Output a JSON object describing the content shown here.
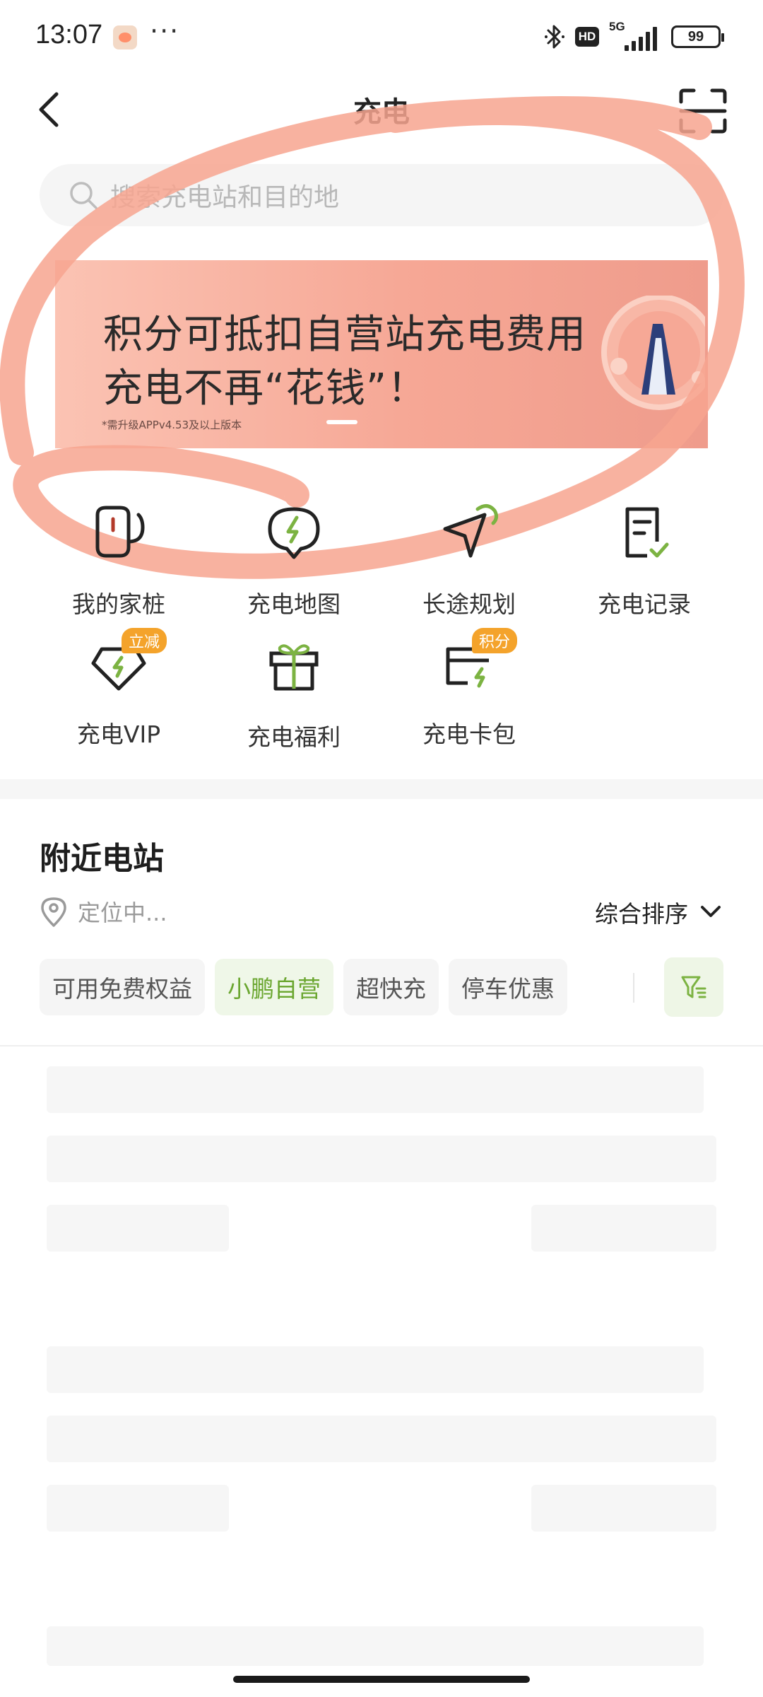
{
  "status_bar": {
    "time": "13:07",
    "dots": "···",
    "hd": "HD",
    "network": "5G",
    "battery": "99"
  },
  "header": {
    "title": "充电"
  },
  "search": {
    "placeholder": "搜索充电站和目的地"
  },
  "banner": {
    "line1": "积分可抵扣自营站充电费用",
    "line2": "充电不再“花钱”！",
    "note": "*需升级APPv4.53及以上版本"
  },
  "shortcuts": [
    {
      "label": "我的家桩",
      "icon": "home-charger-icon"
    },
    {
      "label": "充电地图",
      "icon": "charging-map-icon"
    },
    {
      "label": "长途规划",
      "icon": "route-planning-icon"
    },
    {
      "label": "充电记录",
      "icon": "charging-record-icon"
    },
    {
      "label": "充电VIP",
      "icon": "vip-icon",
      "badge": "立减"
    },
    {
      "label": "充电福利",
      "icon": "gift-icon"
    },
    {
      "label": "充电卡包",
      "icon": "card-wallet-icon",
      "badge": "积分"
    }
  ],
  "nearby": {
    "title": "附近电站",
    "location": "定位中...",
    "sort": "综合排序"
  },
  "filters": [
    "可用免费权益",
    "小鹏自营",
    "超快充",
    "停车优惠"
  ],
  "colors": {
    "accent_green": "#6aa62f",
    "badge_orange": "#f4a32b",
    "annotation": "#f7a48f"
  }
}
